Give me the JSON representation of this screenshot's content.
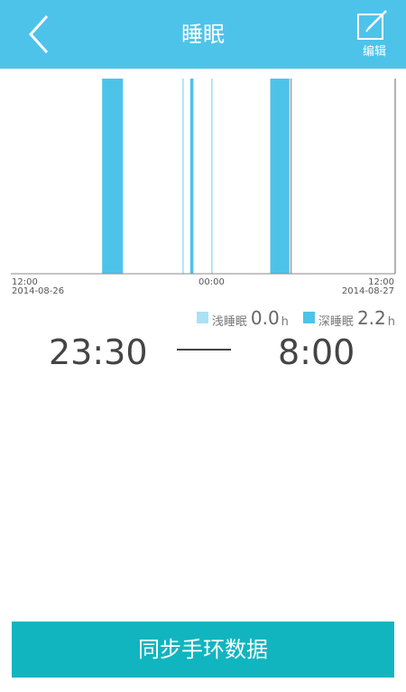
{
  "header": {
    "title": "睡眠",
    "back_icon": "chevron-left-icon",
    "edit_label": "编辑",
    "edit_icon": "edit-icon"
  },
  "chart_data": {
    "type": "bar",
    "x_start_label": "12:00",
    "x_start_date": "2014-08-26",
    "x_mid_label": "00:00",
    "x_end_label": "12:00",
    "x_end_date": "2014-08-27",
    "x_range_hours": [
      0,
      24
    ],
    "deep_sleep_segments": [
      {
        "start": 5.7,
        "end": 7.0
      },
      {
        "start": 11.2,
        "end": 11.4
      },
      {
        "start": 16.2,
        "end": 17.4
      }
    ],
    "light_sleep_segments": [
      {
        "start": 10.7,
        "end": 10.8
      },
      {
        "start": 12.5,
        "end": 12.6
      }
    ],
    "marker_hours": [
      17.5,
      28.4
    ],
    "colors": {
      "deep": "#4ec3ea",
      "light": "#a9e2f5",
      "marker": "#999999",
      "axis": "#888888"
    }
  },
  "legend": {
    "light_label": "浅睡眠",
    "light_value": "0.0",
    "light_unit": "h",
    "deep_label": "深睡眠",
    "deep_value": "2.2",
    "deep_unit": "h"
  },
  "times": {
    "start": "23:30",
    "end": "8:00"
  },
  "sync_button": {
    "label": "同步手环数据"
  }
}
